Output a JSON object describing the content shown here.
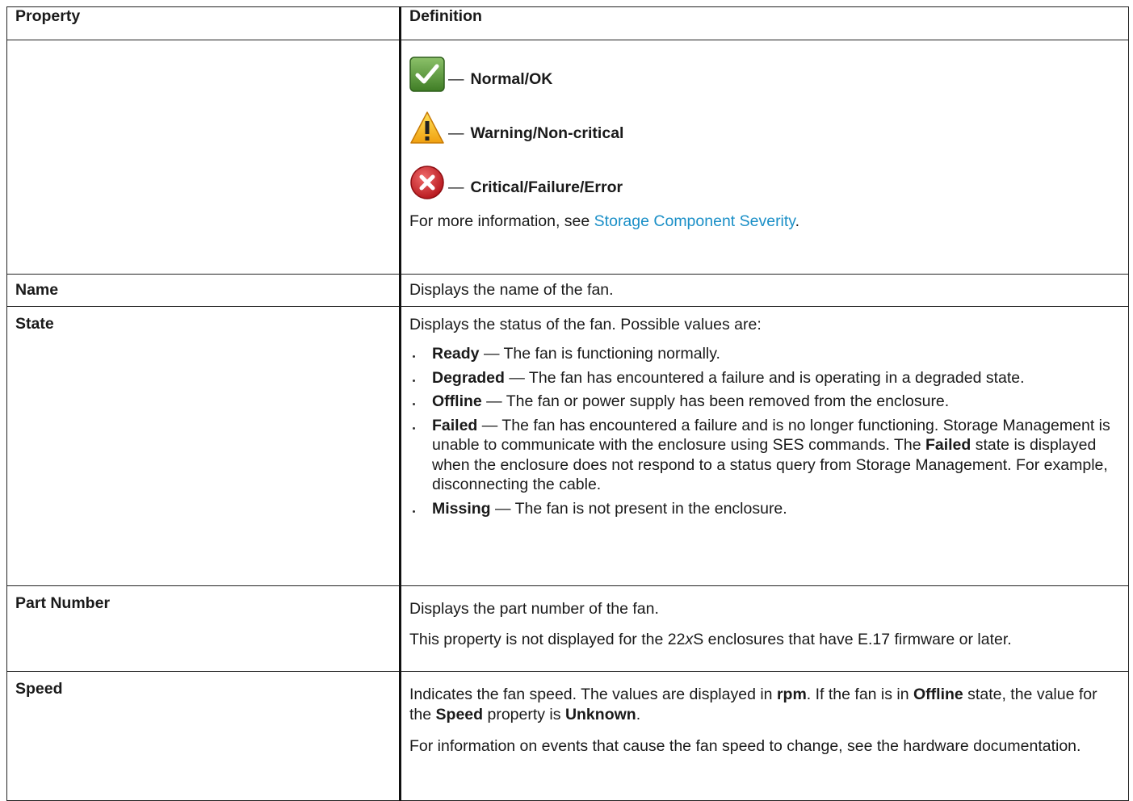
{
  "table": {
    "header": {
      "property": "Property",
      "definition": "Definition"
    },
    "severity": {
      "items": [
        {
          "icon": "check-ok-icon",
          "dash": "—",
          "label": "Normal/OK"
        },
        {
          "icon": "warning-triangle-icon",
          "dash": "—",
          "label": "Warning/Non-critical"
        },
        {
          "icon": "critical-x-icon",
          "dash": "—",
          "label": "Critical/Failure/Error"
        }
      ],
      "more_prefix": "For more information, see ",
      "more_link": "Storage Component Severity",
      "more_suffix": "."
    },
    "name": {
      "label": "Name",
      "text": "Displays the name of the fan."
    },
    "state": {
      "label": "State",
      "intro": "Displays the status of the fan. Possible values are:",
      "items": [
        {
          "term": "Ready",
          "text": " — The fan is functioning normally."
        },
        {
          "term": "Degraded",
          "text": " — The fan has encountered a failure and is operating in a degraded state."
        },
        {
          "term": "Offline",
          "text": " — The fan or power supply has been removed from the enclosure."
        },
        {
          "term": "Failed",
          "text": " — The fan has encountered a failure and is no longer functioning. Storage Management is unable to communicate with the enclosure using SES commands. The ",
          "term2": "Failed",
          "text2": " state is displayed when the enclosure does not respond to a status query from Storage Management. For example, disconnecting the cable."
        },
        {
          "term": "Missing",
          "text": " — The fan is not present in the enclosure."
        }
      ]
    },
    "part_number": {
      "label": "Part Number",
      "text1": "Displays the part number of the fan.",
      "text2_pre": "This property is not displayed for the 22",
      "text2_italic": "x",
      "text2_post": "S enclosures that have E.17 firmware or later."
    },
    "speed": {
      "label": "Speed",
      "p1_a": "Indicates the fan speed. The values are displayed in ",
      "p1_b": "rpm",
      "p1_c": ". If the fan is in ",
      "p1_d": "Offline",
      "p1_e": " state, the value for the ",
      "p1_f": "Speed",
      "p1_g": " property is ",
      "p1_h": "Unknown",
      "p1_i": ".",
      "p2": "For information on events that cause the fan speed to change, see the hardware documentation."
    }
  }
}
